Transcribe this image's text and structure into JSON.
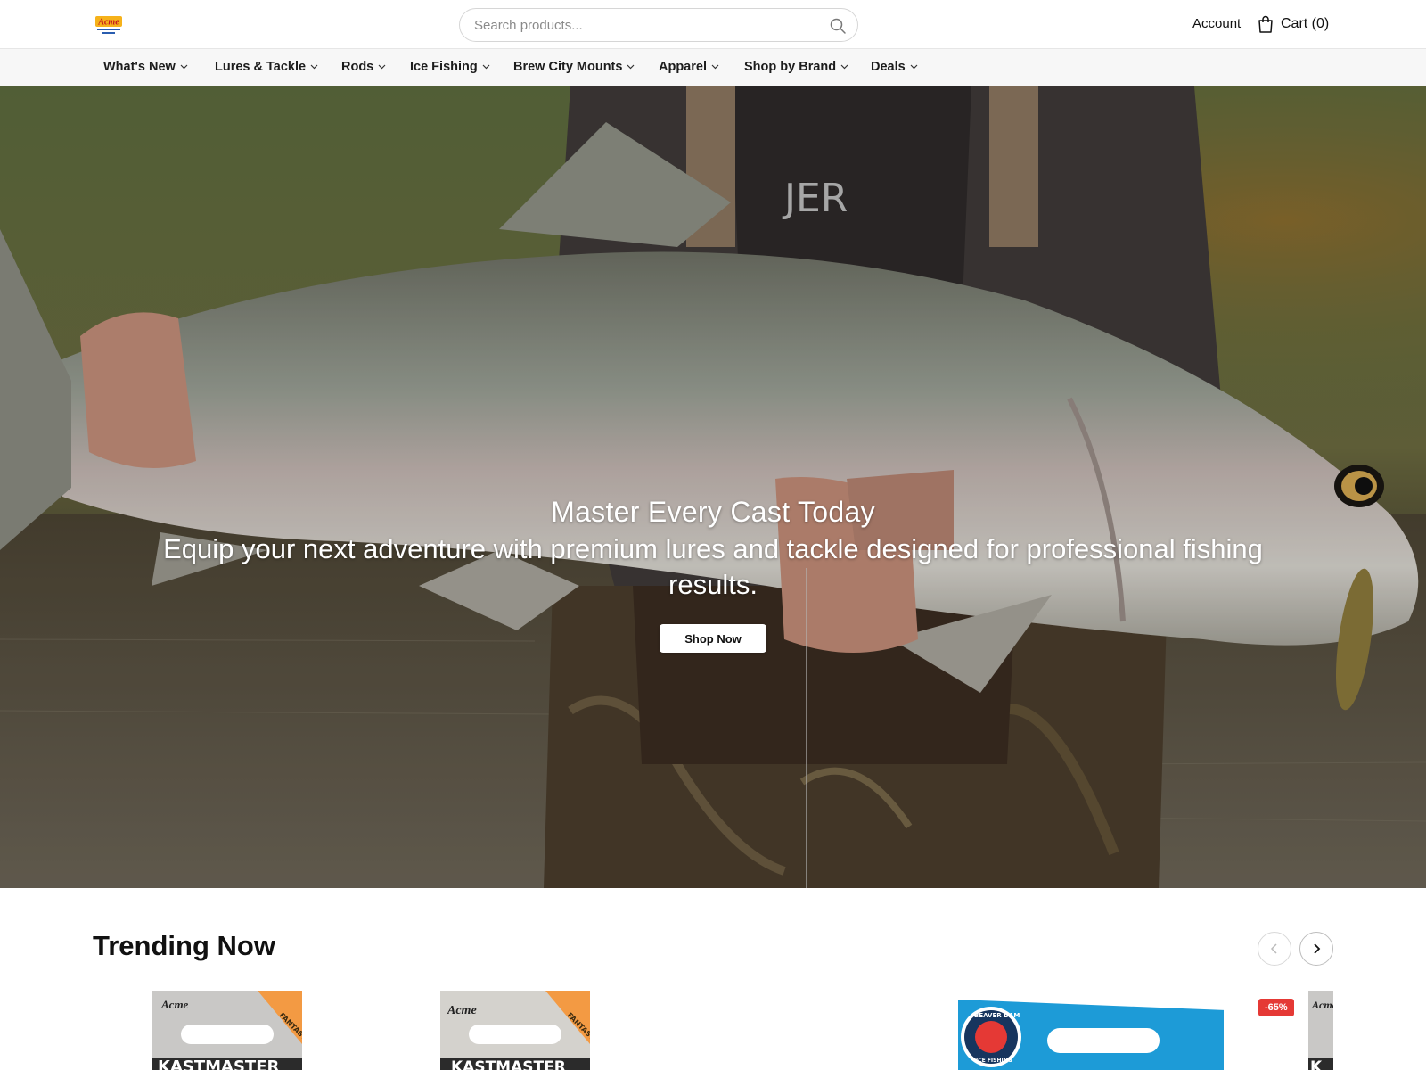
{
  "header": {
    "logo_alt": "Acme",
    "search_placeholder": "Search products...",
    "account_label": "Account",
    "cart_label": "Cart (0)"
  },
  "nav": {
    "items": [
      {
        "label": "What's New"
      },
      {
        "label": "Lures & Tackle"
      },
      {
        "label": "Rods"
      },
      {
        "label": "Ice Fishing"
      },
      {
        "label": "Brew City Mounts"
      },
      {
        "label": "Apparel"
      },
      {
        "label": "Shop by Brand"
      },
      {
        "label": "Deals"
      }
    ]
  },
  "hero": {
    "title": "Master Every Cast Today",
    "subtitle": "Equip your next adventure with premium lures and tackle designed for professional fishing results.",
    "cta_label": "Shop Now"
  },
  "trending": {
    "title": "Trending Now",
    "products": [
      {
        "brand": "Acme",
        "name": "KASTMASTER",
        "tag": "FANTASTIC"
      },
      {
        "brand": "Acme",
        "name": "KASTMASTER",
        "tag": "FANTASTIC"
      },
      {
        "brand": "",
        "name": "",
        "tag": ""
      },
      {
        "brand": "BEAVER DAM",
        "name": "ICE FISHING",
        "tag": ""
      },
      {
        "brand": "Acme",
        "name": "K",
        "tag": ""
      }
    ],
    "discount_badge": "-65%"
  },
  "colors": {
    "accent": "#111111",
    "badge": "#e53935",
    "nav_bg": "#f7f7f7"
  }
}
